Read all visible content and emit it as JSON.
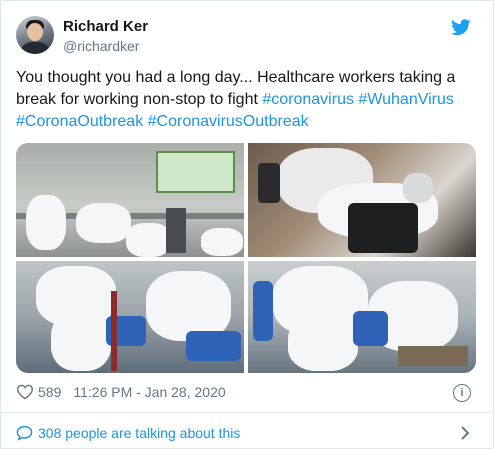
{
  "author": {
    "name": "Richard Ker",
    "handle": "@richardker"
  },
  "tweet": {
    "text_plain": "You thought you had a long day... Healthcare workers taking a break for working non-stop to fight ",
    "hashtags": [
      "#coronavirus",
      "#WuhanVirus",
      "#CoronaOutbreak",
      "#CoronavirusOutbreak"
    ]
  },
  "meta": {
    "likes": "589",
    "timestamp": "11:26 PM - Jan 28, 2020"
  },
  "footer": {
    "talking": "308 people are talking about this"
  },
  "icons": [
    "twitter-bird-icon",
    "heart-icon",
    "info-icon",
    "speech-bubble-icon",
    "chevron-right-icon"
  ],
  "colors": {
    "link": "#1b95e0",
    "secondary": "#657786",
    "border": "#e1e8ed"
  }
}
